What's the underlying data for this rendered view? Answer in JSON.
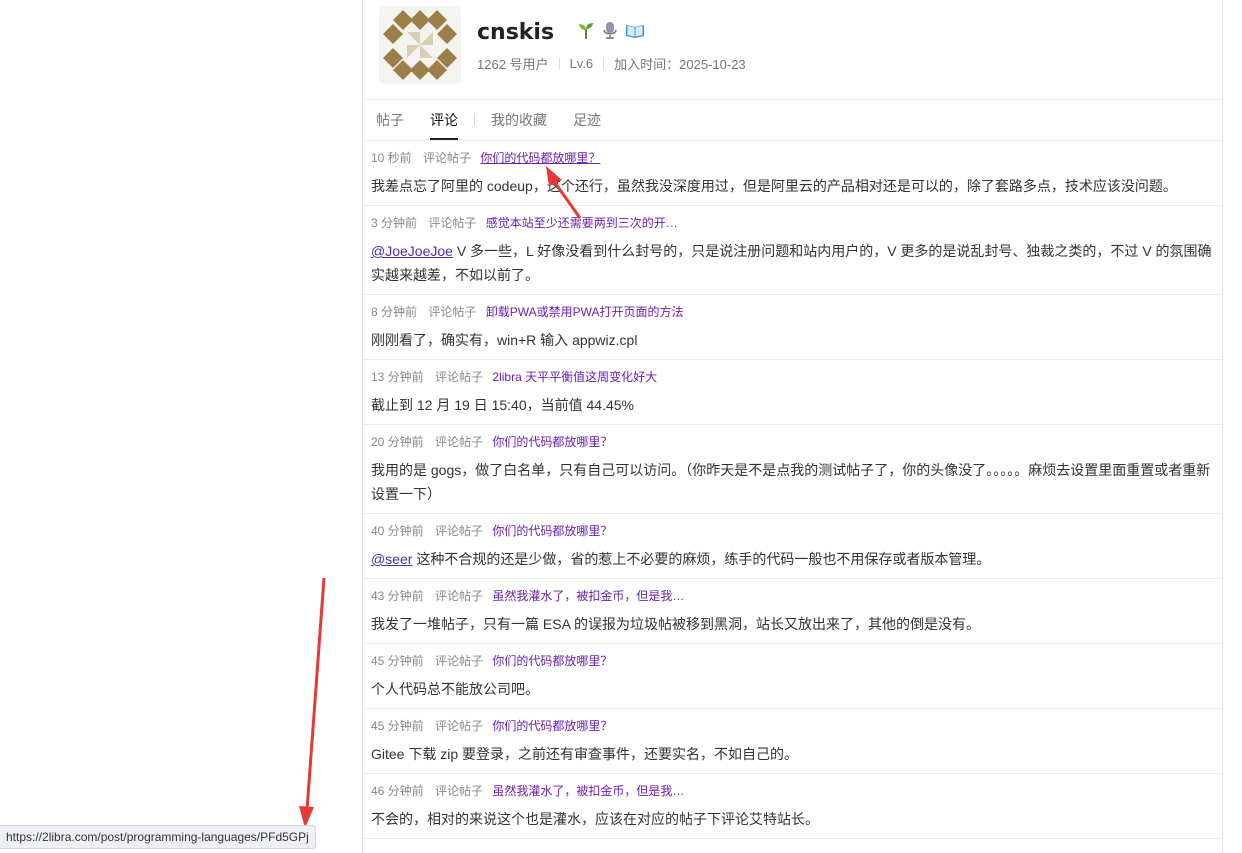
{
  "profile": {
    "username": "cnskis",
    "badges": [
      "seedling-icon",
      "microphone-icon",
      "book-icon"
    ],
    "user_number": "1262 号用户",
    "level": "Lv.6",
    "join_label": "加入时间：2025-10-23"
  },
  "tabs": [
    {
      "label": "帖子",
      "active": false
    },
    {
      "label": "评论",
      "active": true
    },
    {
      "label": "我的收藏",
      "active": false
    },
    {
      "label": "足迹",
      "active": false
    }
  ],
  "comment_kind": "评论帖子",
  "comments": [
    {
      "time": "10 秒前",
      "post": "你们的代码都放哪里？",
      "text": "我差点忘了阿里的 codeup，这个还行，虽然我没深度用过，但是阿里云的产品相对还是可以的，除了套路多点，技术应该没问题。"
    },
    {
      "time": "3 分钟前",
      "post": "感觉本站至少还需要两到三次的开…",
      "mention": "@JoeJoeJoe",
      "text": " V 多一些，L 好像没看到什么封号的，只是说注册问题和站内用户的，V 更多的是说乱封号、独裁之类的，不过 V 的氛围确实越来越差，不如以前了。"
    },
    {
      "time": "8 分钟前",
      "post": "卸载PWA或禁用PWA打开页面的方法",
      "text": "刚刚看了，确实有，win+R 输入 appwiz.cpl"
    },
    {
      "time": "13 分钟前",
      "post": "2libra 天平平衡值这周变化好大",
      "text": "截止到 12 月 19 日 15:40，当前值 44.45%"
    },
    {
      "time": "20 分钟前",
      "post": "你们的代码都放哪里？",
      "text": "我用的是 gogs，做了白名单，只有自己可以访问。（你昨天是不是点我的测试帖子了，你的头像没了。。。。。麻烦去设置里面重置或者重新设置一下）"
    },
    {
      "time": "40 分钟前",
      "post": "你们的代码都放哪里？",
      "mention": "@seer",
      "text": " 这种不合规的还是少做，省的惹上不必要的麻烦，练手的代码一般也不用保存或者版本管理。"
    },
    {
      "time": "43 分钟前",
      "post": "虽然我灌水了，被扣金币，但是我…",
      "text": "我发了一堆帖子，只有一篇 ESA 的误报为垃圾帖被移到黑洞，站长又放出来了，其他的倒是没有。"
    },
    {
      "time": "45 分钟前",
      "post": "你们的代码都放哪里？",
      "text": "个人代码总不能放公司吧。"
    },
    {
      "time": "45 分钟前",
      "post": "你们的代码都放哪里？",
      "text": "Gitee 下载 zip 要登录，之前还有审查事件，还要实名，不如自己的。"
    },
    {
      "time": "46 分钟前",
      "post": "虽然我灌水了，被扣金币，但是我…",
      "text": "不会的，相对的来说这个也是灌水，应该在对应的帖子下评论艾特站长。"
    }
  ],
  "status_bar": "https://2libra.com/post/programming-languages/PFd5GPj",
  "colors": {
    "link": "#6a1fb5",
    "arrow": "#e53935",
    "avatar": "#9c7f48"
  }
}
